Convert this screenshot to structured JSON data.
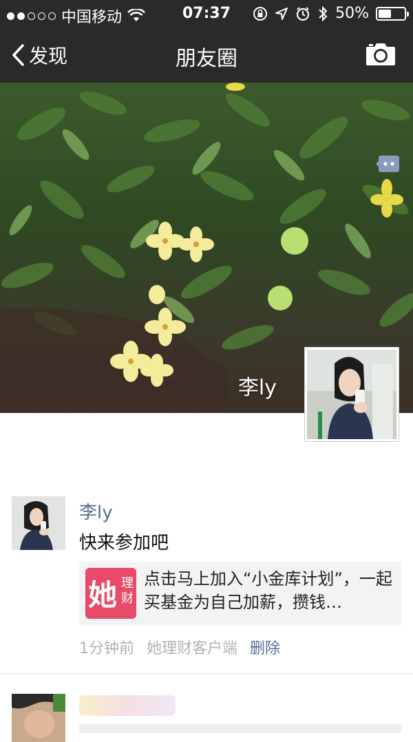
{
  "status_bar": {
    "carrier": "中国移动",
    "time": "07:37",
    "battery_text": "50%",
    "battery_level": 0.5,
    "signal_bars_filled": 2,
    "signal_bars_total": 5
  },
  "nav": {
    "back_label": "发现",
    "title": "朋友圈",
    "icons": [
      "back-arrow-icon",
      "camera-icon"
    ]
  },
  "cover": {
    "user_name": "李ly"
  },
  "post": {
    "author": "李ly",
    "text": "快来参加吧",
    "share": {
      "logo_big": "她",
      "logo_small": "理财",
      "title": "点击马上加入“小金库计划”，一起买基金为自己加薪，攒钱…"
    },
    "time": "1分钟前",
    "source": "她理财客户端",
    "delete_label": "删除"
  },
  "colors": {
    "bar_bg": "#2a2a2a",
    "link_blue": "#576b95",
    "meta_gray": "#b2b2b2",
    "share_bg": "#f3f3f5",
    "logo_pink": "#e84a6a"
  }
}
